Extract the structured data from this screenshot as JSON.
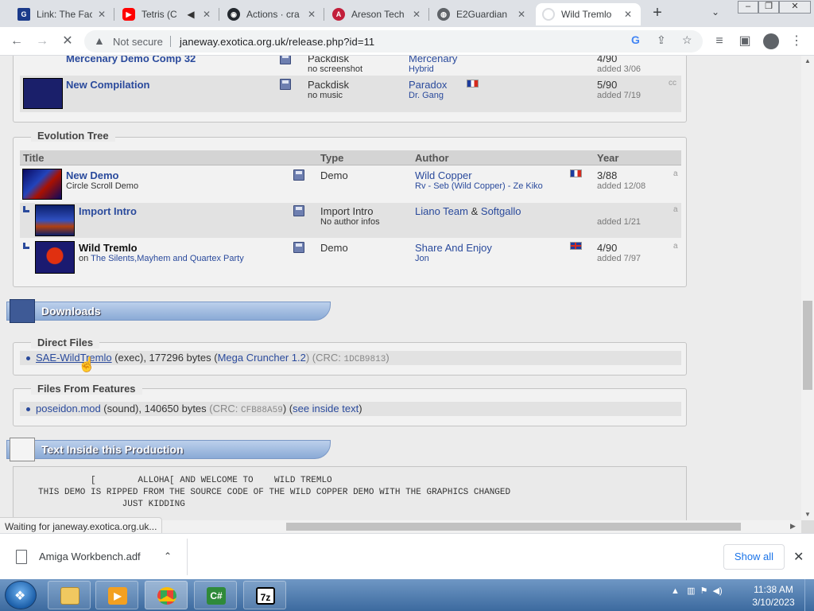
{
  "browser": {
    "tabs": [
      {
        "title": "Link: The Fac",
        "favicon": "G",
        "favicon_color": "#1a3a8a"
      },
      {
        "title": "Tetris (C",
        "favicon": "▶",
        "favicon_color": "#ff0000",
        "audio": true
      },
      {
        "title": "Actions · cra",
        "favicon": "◉",
        "favicon_color": "#24292f"
      },
      {
        "title": "Areson Tech",
        "favicon": "A",
        "favicon_color": "#c21e3a"
      },
      {
        "title": "E2Guardian",
        "favicon": "◍",
        "favicon_color": "#5f6368"
      },
      {
        "title": "Wild Tremlo",
        "favicon": "◌",
        "favicon_color": "#9aa0a6",
        "active": true
      }
    ],
    "new_tab": "+",
    "omnibox": {
      "security_label": "Not secure",
      "url": "janeway.exotica.org.uk/release.php?id=11"
    },
    "status": "Waiting for janeway.exotica.org.uk..."
  },
  "page": {
    "compilation_rows": [
      {
        "title": "Mercenary Demo Comp 32",
        "type": "Packdisk",
        "sub": "no screenshot",
        "author": "Mercenary",
        "group": "Hybrid",
        "year": "4/90",
        "added": "added 3/06"
      },
      {
        "title": "New Compilation",
        "type": "Packdisk",
        "sub": "no music",
        "author": "Paradox",
        "group": "Dr. Gang",
        "year": "5/90",
        "added": "added 7/19",
        "platform": "cc",
        "flag": "fr"
      }
    ],
    "evolution_tree": {
      "legend": "Evolution Tree",
      "headers": {
        "title": "Title",
        "type": "Type",
        "author": "Author",
        "year": "Year"
      },
      "rows": [
        {
          "title": "New Demo",
          "sub": "Circle Scroll Demo",
          "type": "Demo",
          "type_sub": "",
          "author": "Wild Copper",
          "author_sub": "Rv - Seb (Wild Copper) - Ze Kiko",
          "year": "3/88",
          "added": "added 12/08",
          "platform": "a",
          "flag": "fr"
        },
        {
          "title": "Import Intro",
          "sub": "",
          "type": "Import Intro",
          "type_sub": "No author infos",
          "author": "Liano Team",
          "author_amp": "&",
          "author2": "Softgallo",
          "year": "",
          "added": "added 1/21",
          "platform": "a"
        },
        {
          "title": "Wild Tremlo",
          "sub_prefix": "on",
          "sub_link": "The Silents,Mayhem and Quartex Party",
          "type": "Demo",
          "author": "Share And Enjoy",
          "author_sub": "Jon",
          "year": "4/90",
          "added": "added 7/97",
          "platform": "a",
          "flag": "uk"
        }
      ]
    },
    "downloads": {
      "header": "Downloads",
      "direct_legend": "Direct Files",
      "direct_file": {
        "name": "SAE-WildTremlo",
        "kind": "(exec), 177296 bytes (",
        "cruncher": "Mega Cruncher 1.2",
        "crc_open": ") (CRC: ",
        "crc": "1DCB9813",
        "crc_close": ")"
      },
      "features_legend": "Files From Features",
      "feature_file": {
        "name": "poseidon.mod",
        "kind": "(sound), 140650 bytes ",
        "crc_open": "(CRC: ",
        "crc": "CFB88A59",
        "crc_close": ") (",
        "see": "see inside text",
        "tail": ")"
      }
    },
    "text_inside": {
      "header": "Text Inside this Production",
      "lines": [
        "          [        ALLOHA[ AND WELCOME TO    WILD TREMLO",
        "THIS DEMO IS RIPPED FROM THE SOURCE CODE OF THE WILD COPPER DEMO WITH THE GRAPHICS CHANGED",
        "                JUST KIDDING"
      ]
    }
  },
  "download_shelf": {
    "file": "Amiga Workbench.adf",
    "show_all": "Show all"
  },
  "taskbar": {
    "apps": [
      {
        "name": "explorer",
        "label": "",
        "active": false
      },
      {
        "name": "media-player",
        "label": "▶",
        "active": false
      },
      {
        "name": "chrome",
        "label": "",
        "active": true
      },
      {
        "name": "csharp",
        "label": "C#",
        "active": false
      },
      {
        "name": "7zip",
        "label": "7z",
        "active": false
      }
    ],
    "time": "11:38 AM",
    "date": "3/10/2023"
  }
}
